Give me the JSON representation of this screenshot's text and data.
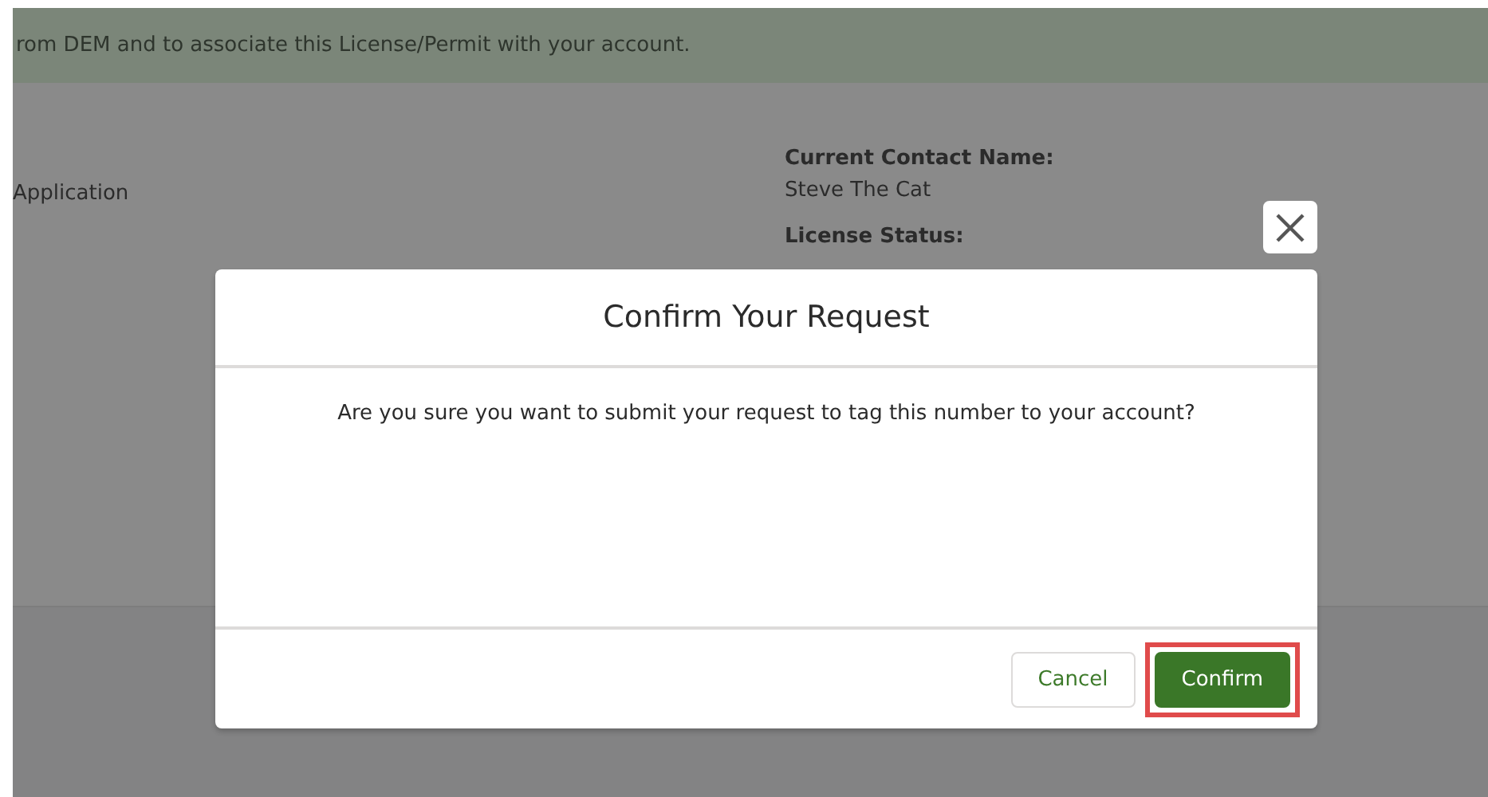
{
  "background": {
    "banner": "rom DEM and to associate this License/Permit with your account.",
    "left_text": "Application",
    "fields": [
      {
        "label": "Current Contact Name:",
        "value": "Steve The Cat"
      },
      {
        "label": "License Status:"
      }
    ]
  },
  "modal": {
    "title": "Confirm Your Request",
    "message": "Are you sure you want to submit your request to tag this number to your account?",
    "buttons": [
      {
        "label": "Cancel",
        "kind": "neutral",
        "highlighted": false
      },
      {
        "label": "Confirm",
        "kind": "brand",
        "highlighted": true
      }
    ]
  }
}
